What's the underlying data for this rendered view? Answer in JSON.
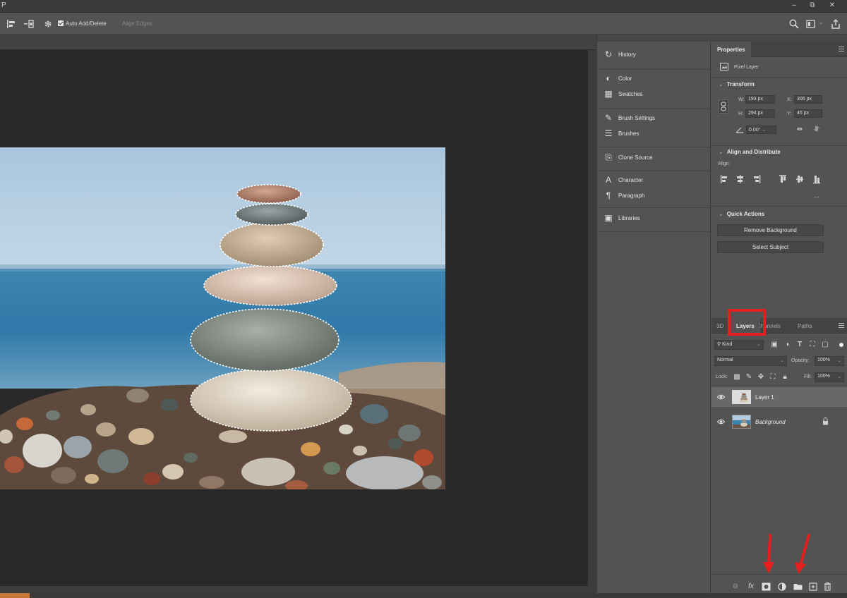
{
  "titlebar": {
    "app_char": "P",
    "minimize": "–",
    "restore": "⧉",
    "close": "✕"
  },
  "options_bar": {
    "auto_add_delete_label": "Auto Add/Delete",
    "auto_add_delete_checked": true,
    "align_edges_label": "Align Edges"
  },
  "collapsed_panels": {
    "groups": [
      {
        "items": [
          {
            "label": "History",
            "icon": "history-icon"
          }
        ]
      },
      {
        "items": [
          {
            "label": "Color",
            "icon": "color-icon"
          },
          {
            "label": "Swatches",
            "icon": "swatches-icon"
          }
        ]
      },
      {
        "items": [
          {
            "label": "Brush Settings",
            "icon": "brush-settings-icon"
          },
          {
            "label": "Brushes",
            "icon": "brushes-icon"
          }
        ]
      },
      {
        "items": [
          {
            "label": "Clone Source",
            "icon": "clone-source-icon"
          }
        ]
      },
      {
        "items": [
          {
            "label": "Character",
            "icon": "character-icon"
          },
          {
            "label": "Paragraph",
            "icon": "paragraph-icon"
          }
        ]
      },
      {
        "items": [
          {
            "label": "Libraries",
            "icon": "libraries-icon"
          }
        ]
      }
    ]
  },
  "properties": {
    "tab_label": "Properties",
    "layer_kind": "Pixel Layer",
    "transform": {
      "title": "Transform",
      "w_label": "W:",
      "w_value": "193 px",
      "h_label": "H:",
      "h_value": "294 px",
      "x_label": "X:",
      "x_value": "306 px",
      "y_label": "Y:",
      "y_value": "45 px",
      "angle_value": "0.00°"
    },
    "align": {
      "title": "Align and Distribute",
      "align_label": "Align:",
      "more": "..."
    },
    "quick_actions": {
      "title": "Quick Actions",
      "remove_background": "Remove Background",
      "select_subject": "Select Subject"
    }
  },
  "layers_panel": {
    "tabs": [
      {
        "label": "3D"
      },
      {
        "label": "Layers"
      },
      {
        "label": "Channels"
      },
      {
        "label": "Paths"
      }
    ],
    "active_tab": "Layers",
    "filter_kind": "Kind",
    "blend_mode": "Normal",
    "opacity_label": "Opacity:",
    "opacity_value": "100%",
    "lock_label": "Lock:",
    "fill_label": "Fill:",
    "fill_value": "100%",
    "layers": [
      {
        "name": "Layer 1",
        "visible": true,
        "selected": true,
        "locked": false
      },
      {
        "name": "Background",
        "visible": true,
        "selected": false,
        "locked": true
      }
    ],
    "bottom_icons": [
      "link-layers-icon",
      "fx-icon",
      "add-mask-icon",
      "adjustment-layer-icon",
      "new-group-icon",
      "new-layer-icon",
      "delete-layer-icon"
    ],
    "fx_label": "fx"
  },
  "annotations": {
    "highlight_color": "#e51f1f"
  }
}
